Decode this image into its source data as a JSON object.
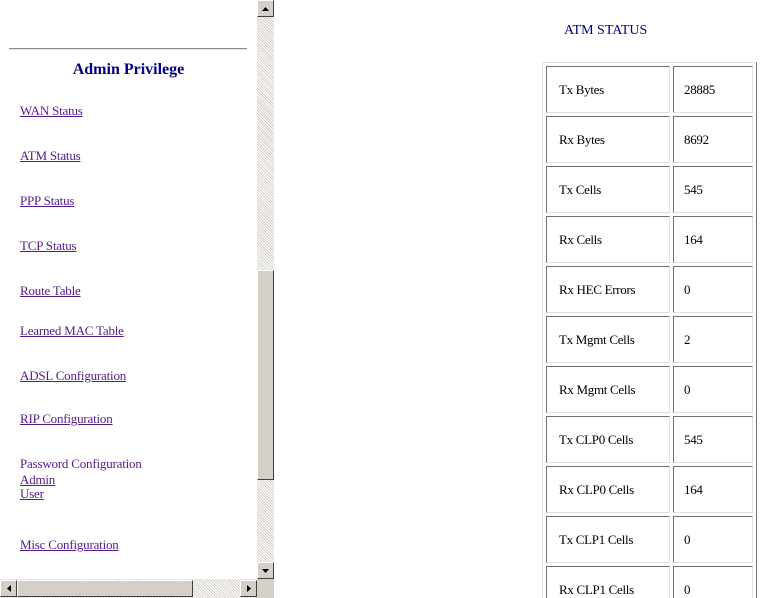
{
  "sidebar": {
    "heading": "Admin Privilege",
    "links": [
      {
        "label": "WAN Status"
      },
      {
        "label": "ATM Status"
      },
      {
        "label": "PPP Status"
      },
      {
        "label": "TCP Status"
      },
      {
        "label": "Route Table"
      },
      {
        "label": "Learned MAC Table"
      },
      {
        "label": "ADSL Configuration"
      },
      {
        "label": "RIP Configuration"
      }
    ],
    "password_config": {
      "label": "Password Configuration",
      "sub_links": [
        "Admin",
        "User"
      ]
    },
    "misc_config": "Misc Configuration"
  },
  "main": {
    "title": "ATM STATUS",
    "rows": [
      {
        "label": "Tx Bytes",
        "value": "28885"
      },
      {
        "label": "Rx Bytes",
        "value": "8692"
      },
      {
        "label": "Tx Cells",
        "value": "545"
      },
      {
        "label": "Rx Cells",
        "value": "164"
      },
      {
        "label": "Rx HEC Errors",
        "value": "0"
      },
      {
        "label": "Tx Mgmt Cells",
        "value": "2"
      },
      {
        "label": "Rx Mgmt Cells",
        "value": "0"
      },
      {
        "label": "Tx CLP0 Cells",
        "value": "545"
      },
      {
        "label": "Rx CLP0 Cells",
        "value": "164"
      },
      {
        "label": "Tx CLP1 Cells",
        "value": "0"
      },
      {
        "label": "Rx CLP1 Cells",
        "value": "0"
      }
    ]
  },
  "scrollbars": {
    "up_icon": "arrow-up-icon",
    "down_icon": "arrow-down-icon",
    "left_icon": "arrow-left-icon",
    "right_icon": "arrow-right-icon"
  },
  "colors": {
    "link": "#551a8b",
    "heading": "#000080",
    "scrollbar_face": "#d4d0c8"
  }
}
